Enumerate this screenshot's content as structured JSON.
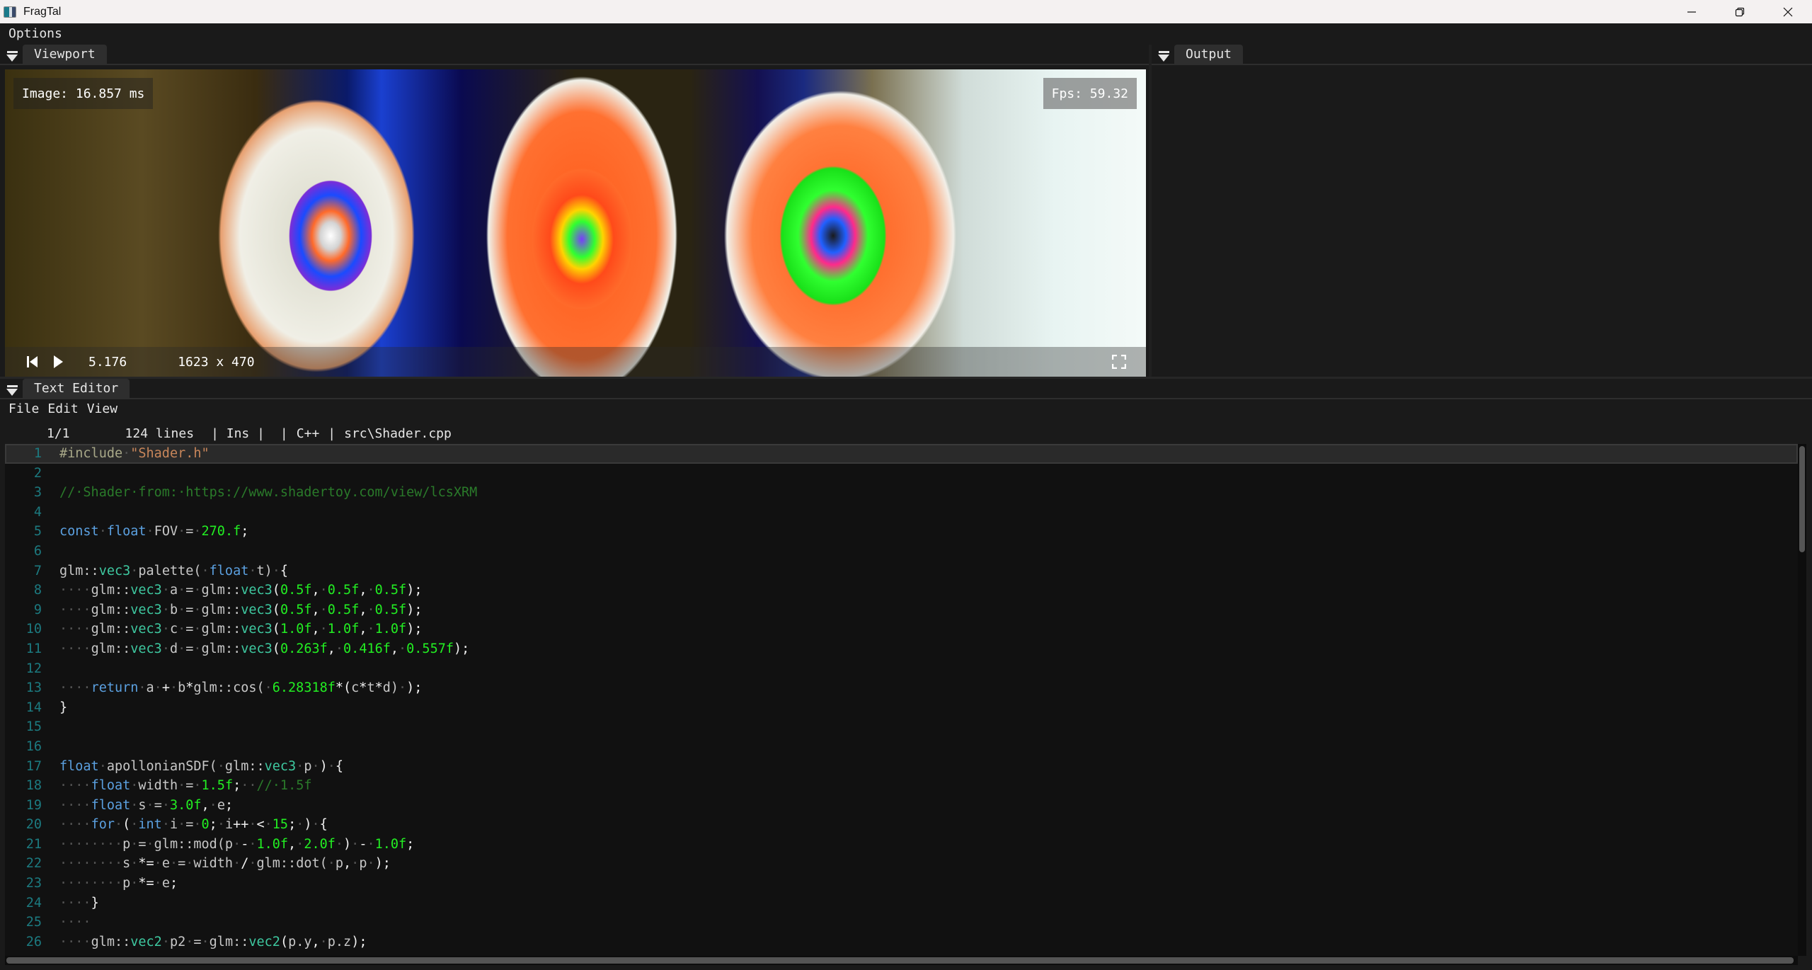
{
  "window": {
    "title": "FragTal",
    "buttons": {
      "minimize": "minimize",
      "restore": "restore",
      "close": "close"
    }
  },
  "main_menu": [
    "Options"
  ],
  "viewport_panel": {
    "tab_label": "Viewport",
    "image_time": "Image: 16.857 ms",
    "fps": "Fps: 59.32",
    "playback_time": "5.176",
    "resolution": "1623 x 470",
    "icons": [
      "skip-back-icon",
      "play-icon",
      "fullscreen-icon"
    ]
  },
  "output_panel": {
    "tab_label": "Output"
  },
  "editor_panel": {
    "tab_label": "Text Editor",
    "menu": [
      "File",
      "Edit",
      "View"
    ],
    "status": {
      "cursor": "1/1",
      "lines": "124 lines",
      "mode": "| Ins |",
      "sep": "|",
      "language": "C++",
      "file": "src\\Shader.cpp"
    },
    "active_line": 1,
    "lines": [
      {
        "n": "1",
        "tokens": [
          [
            "pp",
            "#include"
          ],
          [
            "ws",
            "·"
          ],
          [
            "str",
            "\"Shader.h\""
          ]
        ]
      },
      {
        "n": "2",
        "tokens": []
      },
      {
        "n": "3",
        "tokens": [
          [
            "cm",
            "//·Shader·from:·https://www.shadertoy.com/view/lcsXRM"
          ]
        ]
      },
      {
        "n": "4",
        "tokens": []
      },
      {
        "n": "5",
        "tokens": [
          [
            "kw",
            "const"
          ],
          [
            "ws",
            "·"
          ],
          [
            "kw",
            "float"
          ],
          [
            "ws",
            "·"
          ],
          [
            "id",
            "FOV"
          ],
          [
            "ws",
            "·"
          ],
          [
            "id",
            "="
          ],
          [
            "ws",
            "·"
          ],
          [
            "num",
            "270.f"
          ],
          [
            "op",
            ";"
          ]
        ]
      },
      {
        "n": "6",
        "tokens": []
      },
      {
        "n": "7",
        "tokens": [
          [
            "id",
            "glm::"
          ],
          [
            "type",
            "vec3"
          ],
          [
            "ws",
            "·"
          ],
          [
            "id",
            "palette("
          ],
          [
            "ws",
            "·"
          ],
          [
            "kw",
            "float"
          ],
          [
            "ws",
            "·"
          ],
          [
            "id",
            "t)"
          ],
          [
            "ws",
            "·"
          ],
          [
            "op",
            "{"
          ]
        ]
      },
      {
        "n": "8",
        "tokens": [
          [
            "ws",
            "····"
          ],
          [
            "id",
            "glm::"
          ],
          [
            "type",
            "vec3"
          ],
          [
            "ws",
            "·"
          ],
          [
            "id",
            "a"
          ],
          [
            "ws",
            "·"
          ],
          [
            "id",
            "="
          ],
          [
            "ws",
            "·"
          ],
          [
            "id",
            "glm::"
          ],
          [
            "type",
            "vec3"
          ],
          [
            "op",
            "("
          ],
          [
            "num",
            "0.5f"
          ],
          [
            "op",
            ","
          ],
          [
            "ws",
            "·"
          ],
          [
            "num",
            "0.5f"
          ],
          [
            "op",
            ","
          ],
          [
            "ws",
            "·"
          ],
          [
            "num",
            "0.5f"
          ],
          [
            "op",
            ");"
          ]
        ]
      },
      {
        "n": "9",
        "tokens": [
          [
            "ws",
            "····"
          ],
          [
            "id",
            "glm::"
          ],
          [
            "type",
            "vec3"
          ],
          [
            "ws",
            "·"
          ],
          [
            "id",
            "b"
          ],
          [
            "ws",
            "·"
          ],
          [
            "id",
            "="
          ],
          [
            "ws",
            "·"
          ],
          [
            "id",
            "glm::"
          ],
          [
            "type",
            "vec3"
          ],
          [
            "op",
            "("
          ],
          [
            "num",
            "0.5f"
          ],
          [
            "op",
            ","
          ],
          [
            "ws",
            "·"
          ],
          [
            "num",
            "0.5f"
          ],
          [
            "op",
            ","
          ],
          [
            "ws",
            "·"
          ],
          [
            "num",
            "0.5f"
          ],
          [
            "op",
            ");"
          ]
        ]
      },
      {
        "n": "10",
        "tokens": [
          [
            "ws",
            "····"
          ],
          [
            "id",
            "glm::"
          ],
          [
            "type",
            "vec3"
          ],
          [
            "ws",
            "·"
          ],
          [
            "id",
            "c"
          ],
          [
            "ws",
            "·"
          ],
          [
            "id",
            "="
          ],
          [
            "ws",
            "·"
          ],
          [
            "id",
            "glm::"
          ],
          [
            "type",
            "vec3"
          ],
          [
            "op",
            "("
          ],
          [
            "num",
            "1.0f"
          ],
          [
            "op",
            ","
          ],
          [
            "ws",
            "·"
          ],
          [
            "num",
            "1.0f"
          ],
          [
            "op",
            ","
          ],
          [
            "ws",
            "·"
          ],
          [
            "num",
            "1.0f"
          ],
          [
            "op",
            ");"
          ]
        ]
      },
      {
        "n": "11",
        "tokens": [
          [
            "ws",
            "····"
          ],
          [
            "id",
            "glm::"
          ],
          [
            "type",
            "vec3"
          ],
          [
            "ws",
            "·"
          ],
          [
            "id",
            "d"
          ],
          [
            "ws",
            "·"
          ],
          [
            "id",
            "="
          ],
          [
            "ws",
            "·"
          ],
          [
            "id",
            "glm::"
          ],
          [
            "type",
            "vec3"
          ],
          [
            "op",
            "("
          ],
          [
            "num",
            "0.263f"
          ],
          [
            "op",
            ","
          ],
          [
            "ws",
            "·"
          ],
          [
            "num",
            "0.416f"
          ],
          [
            "op",
            ","
          ],
          [
            "ws",
            "·"
          ],
          [
            "num",
            "0.557f"
          ],
          [
            "op",
            ");"
          ]
        ]
      },
      {
        "n": "12",
        "tokens": []
      },
      {
        "n": "13",
        "tokens": [
          [
            "ws",
            "····"
          ],
          [
            "kw",
            "return"
          ],
          [
            "ws",
            "·"
          ],
          [
            "id",
            "a"
          ],
          [
            "ws",
            "·"
          ],
          [
            "op",
            "+"
          ],
          [
            "ws",
            "·"
          ],
          [
            "id",
            "b"
          ],
          [
            "op",
            "*"
          ],
          [
            "id",
            "glm::cos("
          ],
          [
            "ws",
            "·"
          ],
          [
            "num",
            "6.28318f"
          ],
          [
            "op",
            "*("
          ],
          [
            "id",
            "c"
          ],
          [
            "op",
            "*"
          ],
          [
            "id",
            "t"
          ],
          [
            "op",
            "*"
          ],
          [
            "id",
            "d)"
          ],
          [
            "ws",
            "·"
          ],
          [
            "op",
            ");"
          ]
        ]
      },
      {
        "n": "14",
        "tokens": [
          [
            "op",
            "}"
          ]
        ]
      },
      {
        "n": "15",
        "tokens": []
      },
      {
        "n": "16",
        "tokens": []
      },
      {
        "n": "17",
        "tokens": [
          [
            "kw",
            "float"
          ],
          [
            "ws",
            "·"
          ],
          [
            "id",
            "apollonianSDF("
          ],
          [
            "ws",
            "·"
          ],
          [
            "id",
            "glm::"
          ],
          [
            "type",
            "vec3"
          ],
          [
            "ws",
            "·"
          ],
          [
            "id",
            "p"
          ],
          [
            "ws",
            "·"
          ],
          [
            "op",
            ")"
          ],
          [
            "ws",
            "·"
          ],
          [
            "op",
            "{"
          ]
        ]
      },
      {
        "n": "18",
        "tokens": [
          [
            "ws",
            "····"
          ],
          [
            "kw",
            "float"
          ],
          [
            "ws",
            "·"
          ],
          [
            "id",
            "width"
          ],
          [
            "ws",
            "·"
          ],
          [
            "id",
            "="
          ],
          [
            "ws",
            "·"
          ],
          [
            "num",
            "1.5f"
          ],
          [
            "op",
            ";"
          ],
          [
            "ws",
            "··"
          ],
          [
            "cm",
            "//·1.5f"
          ]
        ]
      },
      {
        "n": "19",
        "tokens": [
          [
            "ws",
            "····"
          ],
          [
            "kw",
            "float"
          ],
          [
            "ws",
            "·"
          ],
          [
            "id",
            "s"
          ],
          [
            "ws",
            "·"
          ],
          [
            "id",
            "="
          ],
          [
            "ws",
            "·"
          ],
          [
            "num",
            "3.0f"
          ],
          [
            "op",
            ","
          ],
          [
            "ws",
            "·"
          ],
          [
            "id",
            "e"
          ],
          [
            "op",
            ";"
          ]
        ]
      },
      {
        "n": "20",
        "tokens": [
          [
            "ws",
            "····"
          ],
          [
            "kw",
            "for"
          ],
          [
            "ws",
            "·"
          ],
          [
            "op",
            "("
          ],
          [
            "ws",
            "·"
          ],
          [
            "kw",
            "int"
          ],
          [
            "ws",
            "·"
          ],
          [
            "id",
            "i"
          ],
          [
            "ws",
            "·"
          ],
          [
            "id",
            "="
          ],
          [
            "ws",
            "·"
          ],
          [
            "num",
            "0"
          ],
          [
            "op",
            ";"
          ],
          [
            "ws",
            "·"
          ],
          [
            "id",
            "i"
          ],
          [
            "op",
            "++"
          ],
          [
            "ws",
            "·"
          ],
          [
            "op",
            "<"
          ],
          [
            "ws",
            "·"
          ],
          [
            "num",
            "15"
          ],
          [
            "op",
            ";"
          ],
          [
            "ws",
            "·"
          ],
          [
            "op",
            ")"
          ],
          [
            "ws",
            "·"
          ],
          [
            "op",
            "{"
          ]
        ]
      },
      {
        "n": "21",
        "tokens": [
          [
            "ws",
            "········"
          ],
          [
            "id",
            "p"
          ],
          [
            "ws",
            "·"
          ],
          [
            "id",
            "="
          ],
          [
            "ws",
            "·"
          ],
          [
            "id",
            "glm::mod(p"
          ],
          [
            "ws",
            "·"
          ],
          [
            "op",
            "-"
          ],
          [
            "ws",
            "·"
          ],
          [
            "num",
            "1.0f"
          ],
          [
            "op",
            ","
          ],
          [
            "ws",
            "·"
          ],
          [
            "num",
            "2.0f"
          ],
          [
            "ws",
            "·"
          ],
          [
            "op",
            ")"
          ],
          [
            "ws",
            "·"
          ],
          [
            "op",
            "-"
          ],
          [
            "ws",
            "·"
          ],
          [
            "num",
            "1.0f"
          ],
          [
            "op",
            ";"
          ]
        ]
      },
      {
        "n": "22",
        "tokens": [
          [
            "ws",
            "········"
          ],
          [
            "id",
            "s"
          ],
          [
            "ws",
            "·"
          ],
          [
            "op",
            "*="
          ],
          [
            "ws",
            "·"
          ],
          [
            "id",
            "e"
          ],
          [
            "ws",
            "·"
          ],
          [
            "id",
            "="
          ],
          [
            "ws",
            "·"
          ],
          [
            "id",
            "width"
          ],
          [
            "ws",
            "·"
          ],
          [
            "op",
            "/"
          ],
          [
            "ws",
            "·"
          ],
          [
            "id",
            "glm::dot("
          ],
          [
            "ws",
            "·"
          ],
          [
            "id",
            "p"
          ],
          [
            "op",
            ","
          ],
          [
            "ws",
            "·"
          ],
          [
            "id",
            "p"
          ],
          [
            "ws",
            "·"
          ],
          [
            "op",
            ");"
          ]
        ]
      },
      {
        "n": "23",
        "tokens": [
          [
            "ws",
            "········"
          ],
          [
            "id",
            "p"
          ],
          [
            "ws",
            "·"
          ],
          [
            "op",
            "*="
          ],
          [
            "ws",
            "·"
          ],
          [
            "id",
            "e"
          ],
          [
            "op",
            ";"
          ]
        ]
      },
      {
        "n": "24",
        "tokens": [
          [
            "ws",
            "····"
          ],
          [
            "op",
            "}"
          ]
        ]
      },
      {
        "n": "25",
        "tokens": [
          [
            "ws",
            "····"
          ]
        ]
      },
      {
        "n": "26",
        "tokens": [
          [
            "ws",
            "····"
          ],
          [
            "id",
            "glm::"
          ],
          [
            "type",
            "vec2"
          ],
          [
            "ws",
            "·"
          ],
          [
            "id",
            "p2"
          ],
          [
            "ws",
            "·"
          ],
          [
            "id",
            "="
          ],
          [
            "ws",
            "·"
          ],
          [
            "id",
            "glm::"
          ],
          [
            "type",
            "vec2"
          ],
          [
            "op",
            "("
          ],
          [
            "id",
            "p.y"
          ],
          [
            "op",
            ","
          ],
          [
            "ws",
            "·"
          ],
          [
            "id",
            "p.z"
          ],
          [
            "op",
            ");"
          ]
        ]
      }
    ]
  },
  "colors": {
    "background": "#1a1a1a",
    "editor_bg": "#111111",
    "line_number": "#1c7a80",
    "keyword": "#5ba0e0",
    "type": "#3ec8a0",
    "number": "#22ee22",
    "comment": "#2a7a2a",
    "string": "#c8865a",
    "preprocessor": "#a8a888"
  }
}
